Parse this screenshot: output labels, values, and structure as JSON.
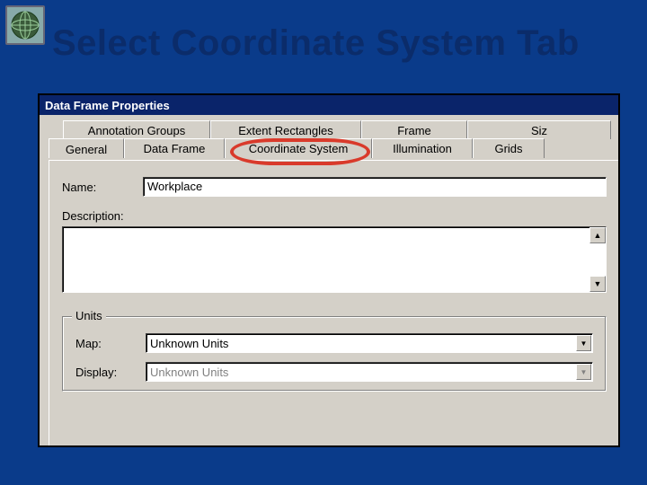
{
  "slide": {
    "title": "Select Coordinate System Tab"
  },
  "dialog": {
    "title": "Data Frame Properties",
    "tabs_back": [
      "Annotation Groups",
      "Extent Rectangles",
      "Frame",
      "Siz"
    ],
    "tabs_front": [
      "General",
      "Data Frame",
      "Coordinate System",
      "Illumination",
      "Grids"
    ],
    "active_tab": "General",
    "fields": {
      "name_label": "Name:",
      "name_value": "Workplace",
      "description_label": "Description:"
    },
    "units": {
      "legend": "Units",
      "map_label": "Map:",
      "map_value": "Unknown Units",
      "display_label": "Display:",
      "display_value": "Unknown Units"
    }
  },
  "icons": {
    "globe": "globe-icon",
    "scroll_up": "▲",
    "scroll_down": "▼",
    "dropdown": "▼"
  }
}
